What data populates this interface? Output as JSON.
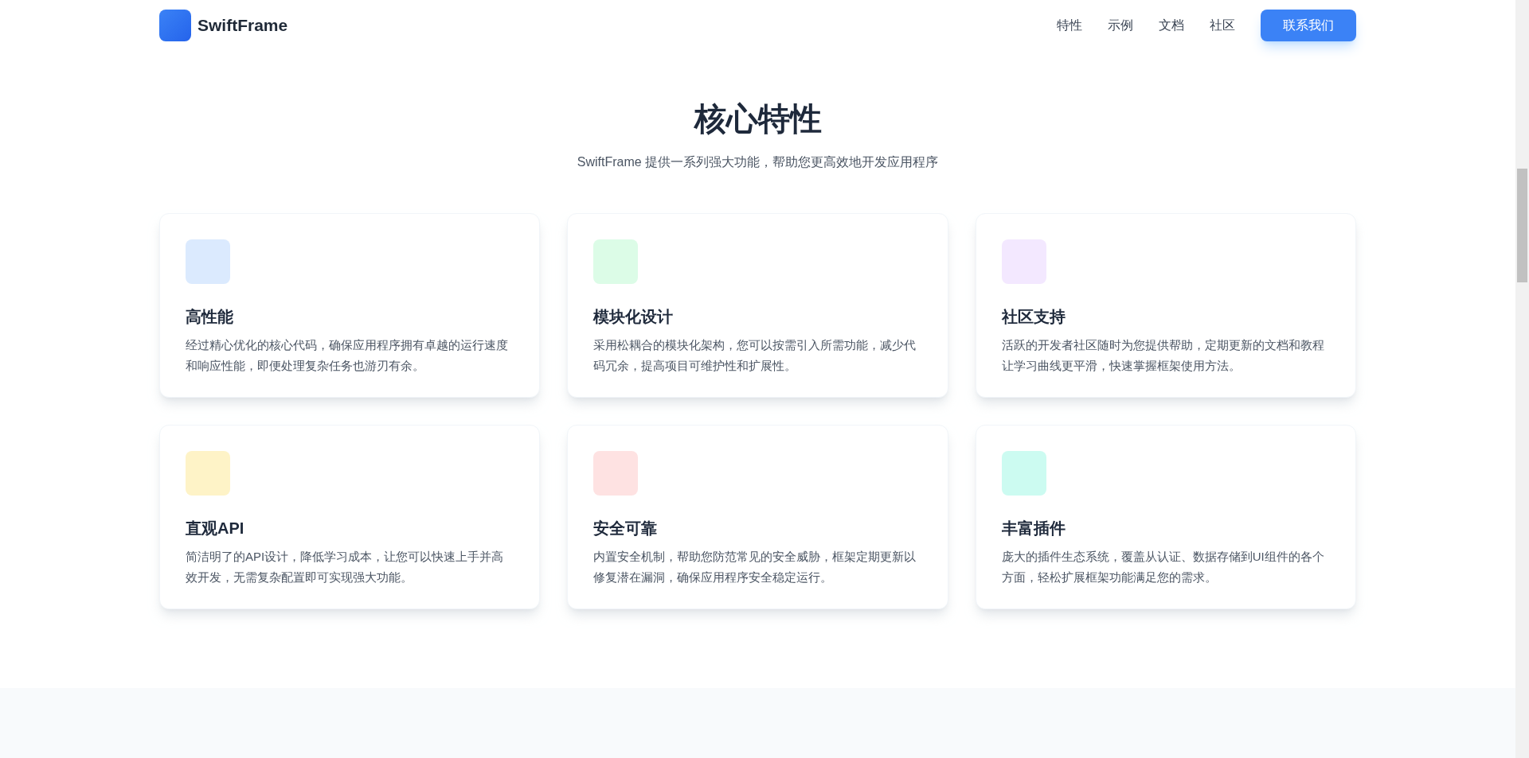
{
  "header": {
    "brand": "SwiftFrame",
    "nav": [
      "特性",
      "示例",
      "文档",
      "社区"
    ],
    "cta": "联系我们"
  },
  "section": {
    "title": "核心特性",
    "subtitle": "SwiftFrame 提供一系列强大功能，帮助您更高效地开发应用程序"
  },
  "features": [
    {
      "title": "高性能",
      "description": "经过精心优化的核心代码，确保应用程序拥有卓越的运行速度和响应性能，即便处理复杂任务也游刃有余。",
      "color": "#dbeafe"
    },
    {
      "title": "模块化设计",
      "description": "采用松耦合的模块化架构，您可以按需引入所需功能，减少代码冗余，提高项目可维护性和扩展性。",
      "color": "#dcfce7"
    },
    {
      "title": "社区支持",
      "description": "活跃的开发者社区随时为您提供帮助，定期更新的文档和教程让学习曲线更平滑，快速掌握框架使用方法。",
      "color": "#f3e8ff"
    },
    {
      "title": "直观API",
      "description": "简洁明了的API设计，降低学习成本，让您可以快速上手并高效开发，无需复杂配置即可实现强大功能。",
      "color": "#fef3c7"
    },
    {
      "title": "安全可靠",
      "description": "内置安全机制，帮助您防范常见的安全威胁，框架定期更新以修复潜在漏洞，确保应用程序安全稳定运行。",
      "color": "#fee2e2"
    },
    {
      "title": "丰富插件",
      "description": "庞大的插件生态系统，覆盖从认证、数据存储到UI组件的各个方面，轻松扩展框架功能满足您的需求。",
      "color": "#ccfbf1"
    }
  ]
}
